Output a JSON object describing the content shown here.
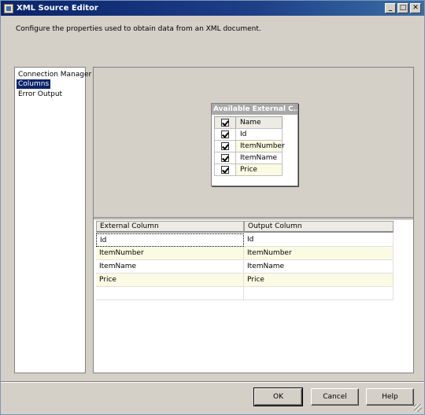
{
  "window": {
    "title": "XML Source Editor",
    "controls": [
      "_",
      "□",
      "✕"
    ]
  },
  "description": "Configure the properties used to obtain data from an XML document.",
  "nav": {
    "items": [
      {
        "label": "Connection Manager",
        "selected": false
      },
      {
        "label": "Columns",
        "selected": true
      },
      {
        "label": "Error Output",
        "selected": false
      }
    ]
  },
  "available_columns": {
    "title": "Available External C...",
    "header": "Name",
    "rows": [
      {
        "name": "Id",
        "checked": true
      },
      {
        "name": "ItemNumber",
        "checked": true
      },
      {
        "name": "ItemName",
        "checked": true
      },
      {
        "name": "Price",
        "checked": true
      }
    ]
  },
  "mapping_grid": {
    "headers": [
      "External Column",
      "Output Column"
    ],
    "rows": [
      [
        "Id",
        "Id"
      ],
      [
        "ItemNumber",
        "ItemNumber"
      ],
      [
        "ItemName",
        "ItemName"
      ],
      [
        "Price",
        "Price"
      ],
      [
        "",
        ""
      ]
    ]
  },
  "buttons": {
    "ok": "OK",
    "cancel": "Cancel",
    "help": "Help"
  },
  "colors": {
    "title_bar": "#0a246a",
    "selection": "#0a246a",
    "face": "#d4d0c8",
    "alt_row": "#fbfbe3"
  }
}
